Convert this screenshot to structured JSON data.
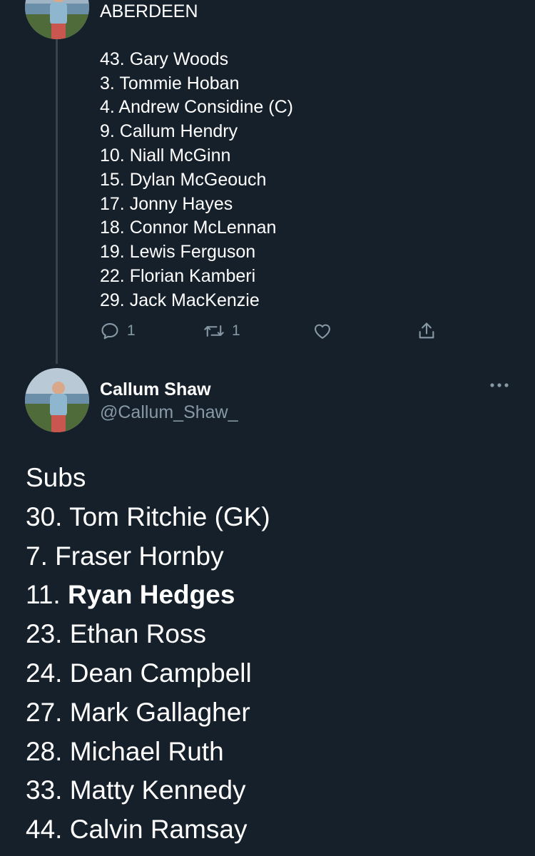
{
  "tweet1": {
    "team": "ABERDEEN",
    "lineup": [
      "43. Gary Woods",
      "3. Tommie Hoban",
      "4. Andrew Considine (C)",
      "9. Callum Hendry",
      "10. Niall McGinn",
      "15. Dylan McGeouch",
      "17. Jonny Hayes",
      "18. Connor McLennan",
      "19. Lewis Ferguson",
      "22. Florian Kamberi",
      "29. Jack MacKenzie"
    ],
    "actions": {
      "reply_count": "1",
      "retweet_count": "1"
    }
  },
  "tweet2": {
    "author_name": "Callum Shaw",
    "author_handle": "@Callum_Shaw_",
    "heading": "Subs",
    "subs": [
      {
        "number": "30.",
        "name": "Tom Ritchie (GK)"
      },
      {
        "number": "7.",
        "name": "Fraser Hornby"
      },
      {
        "number": "11.",
        "name": "Ryan Hedges"
      },
      {
        "number": "23.",
        "name": "Ethan Ross"
      },
      {
        "number": "24.",
        "name": "Dean Campbell"
      },
      {
        "number": "27.",
        "name": "Mark Gallagher"
      },
      {
        "number": "28.",
        "name": "Michael Ruth"
      },
      {
        "number": "33.",
        "name": "Matty Kennedy"
      },
      {
        "number": "44.",
        "name": "Calvin Ramsay"
      }
    ]
  },
  "colors": {
    "background": "#15202b",
    "text": "#ffffff",
    "secondary_text": "#8899a6",
    "thread_line": "#38444d"
  },
  "icons": {
    "reply": "reply-icon",
    "retweet": "retweet-icon",
    "like": "heart-icon",
    "share": "share-icon",
    "more": "more-icon"
  }
}
